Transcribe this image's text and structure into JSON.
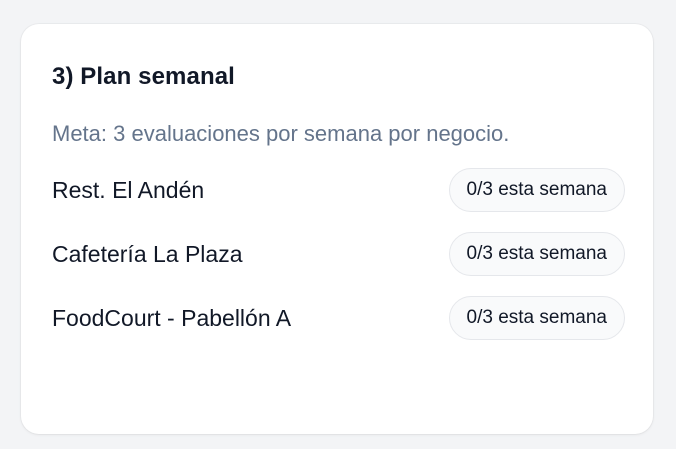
{
  "card": {
    "title": "3) Plan semanal",
    "goal": "Meta: 3 evaluaciones por semana por negocio.",
    "businesses": [
      {
        "name": "Rest. El Andén",
        "progress": "0/3 esta semana"
      },
      {
        "name": "Cafetería La Plaza",
        "progress": "0/3 esta semana"
      },
      {
        "name": "FoodCourt - Pabellón A",
        "progress": "0/3 esta semana"
      }
    ]
  }
}
